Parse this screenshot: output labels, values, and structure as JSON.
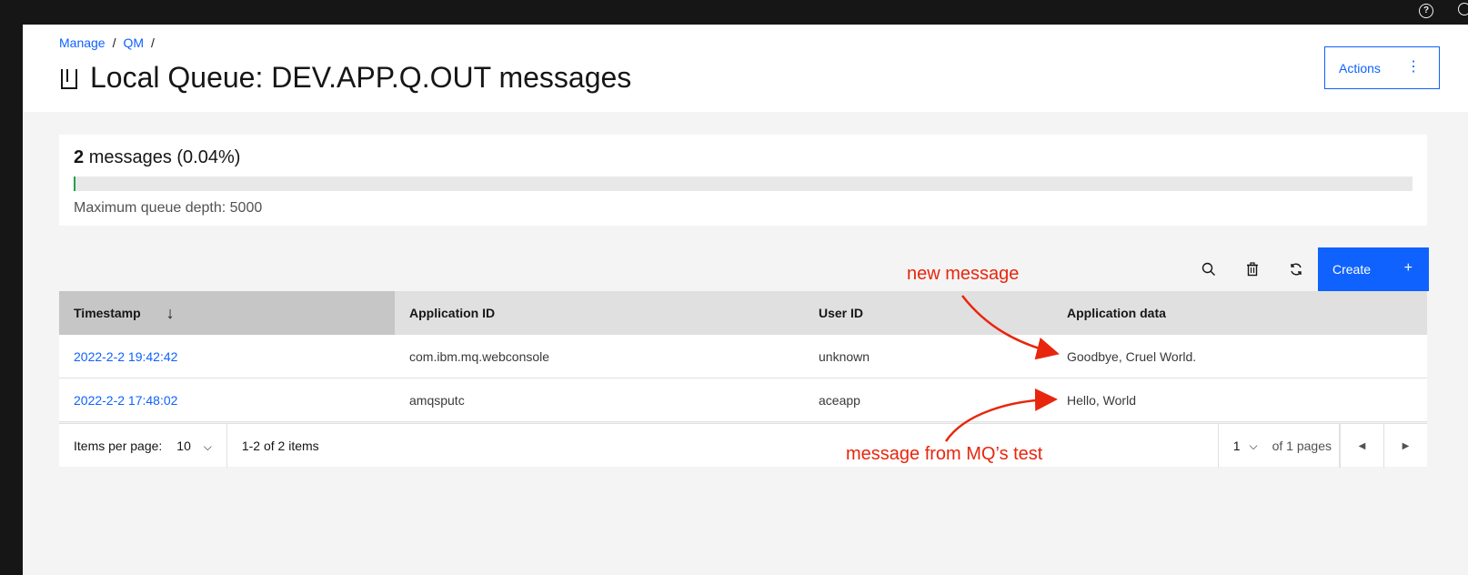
{
  "header": {
    "breadcrumb": [
      "Manage",
      "QM"
    ],
    "title": "Local Queue: DEV.APP.Q.OUT messages",
    "actions_label": "Actions"
  },
  "depth": {
    "count": "2",
    "count_suffix": "messages (0.04%)",
    "percent": 0.04,
    "max_label": "Maximum queue depth: 5000"
  },
  "toolbar": {
    "icons": [
      "search-icon",
      "trash-icon",
      "refresh-icon"
    ],
    "create_label": "Create"
  },
  "table": {
    "columns": [
      "Timestamp",
      "Application ID",
      "User ID",
      "Application data"
    ],
    "rows": [
      {
        "timestamp": "2022-2-2 19:42:42",
        "app_id": "com.ibm.mq.webconsole",
        "user_id": "unknown",
        "app_data": "Goodbye, Cruel World."
      },
      {
        "timestamp": "2022-2-2 17:48:02",
        "app_id": "amqsputc",
        "user_id": "aceapp",
        "app_data": "Hello, World"
      }
    ]
  },
  "pagination": {
    "items_per_page_label": "Items per page:",
    "items_per_page_value": "10",
    "range_text": "1-2 of 2 items",
    "page_value": "1",
    "pages_text": "of 1 pages"
  },
  "annotations": {
    "new_message": "new message",
    "from_test": "message from MQ’s test",
    "color": "#e8260d"
  },
  "colors": {
    "accent": "#0f62fe",
    "topbar": "#161616",
    "depth_fill": "#24a148"
  }
}
